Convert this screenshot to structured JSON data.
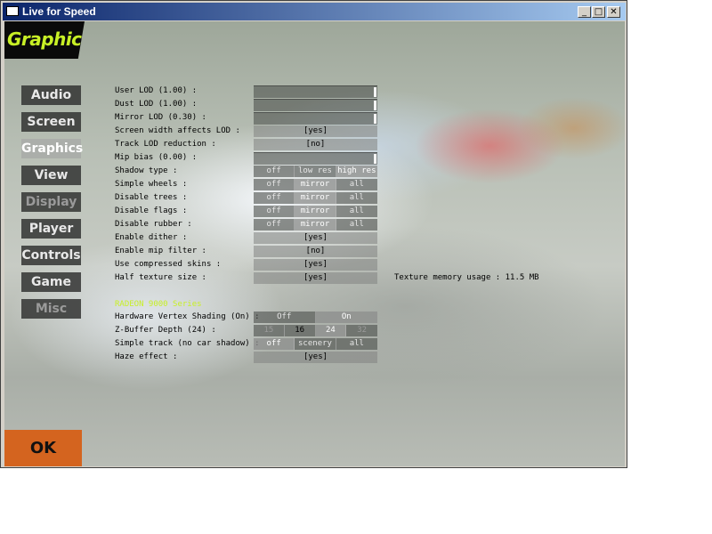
{
  "window": {
    "title": "Live for Speed",
    "minimize": "_",
    "maximize": "□",
    "close": "✕"
  },
  "logo": "Graphics",
  "nav": [
    {
      "label": "Audio",
      "state": "normal"
    },
    {
      "label": "Screen",
      "state": "normal"
    },
    {
      "label": "Graphics",
      "state": "active"
    },
    {
      "label": "View",
      "state": "normal"
    },
    {
      "label": "Display",
      "state": "dim"
    },
    {
      "label": "Player",
      "state": "normal"
    },
    {
      "label": "Controls",
      "state": "normal"
    },
    {
      "label": "Game",
      "state": "normal"
    },
    {
      "label": "Misc",
      "state": "dim"
    }
  ],
  "ok_label": "OK",
  "settings": [
    {
      "label": "User LOD (1.00) :",
      "type": "slider",
      "value": 1.0
    },
    {
      "label": "Dust LOD (1.00) :",
      "type": "slider",
      "value": 1.0
    },
    {
      "label": "Mirror LOD (0.30) :",
      "type": "slider",
      "value": 0.3
    },
    {
      "label": "Screen width affects LOD :",
      "type": "yesno",
      "value": "[yes]"
    },
    {
      "label": "Track LOD reduction :",
      "type": "yesno",
      "value": "[no]"
    },
    {
      "label": "Mip bias (0.00) :",
      "type": "slider",
      "value": 0.0
    },
    {
      "label": "Shadow type :",
      "type": "seg",
      "options": [
        "off",
        "low res",
        "high res"
      ],
      "selected": 2
    },
    {
      "label": "Simple wheels :",
      "type": "seg",
      "options": [
        "off",
        "mirror",
        "all"
      ],
      "selected": 1
    },
    {
      "label": "Disable trees :",
      "type": "seg",
      "options": [
        "off",
        "mirror",
        "all"
      ],
      "selected": 1
    },
    {
      "label": "Disable flags :",
      "type": "seg",
      "options": [
        "off",
        "mirror",
        "all"
      ],
      "selected": 1
    },
    {
      "label": "Disable rubber :",
      "type": "seg",
      "options": [
        "off",
        "mirror",
        "all"
      ],
      "selected": 1
    },
    {
      "label": "Enable dither :",
      "type": "yesno",
      "value": "[yes]"
    },
    {
      "label": "Enable mip filter :",
      "type": "yesno",
      "value": "[no]"
    },
    {
      "label": "Use compressed skins :",
      "type": "yesno",
      "value": "[yes]"
    },
    {
      "label": "Half texture size :",
      "type": "yesno",
      "value": "[yes]"
    }
  ],
  "texture_memory": "Texture memory usage : 11.5 MB",
  "hardware_section": "RADEON 9000 Series",
  "hardware_settings": [
    {
      "label": "Hardware Vertex Shading (On) :",
      "type": "seg",
      "options": [
        "Off",
        "On"
      ],
      "selected": 1
    },
    {
      "label": "Z-Buffer Depth (24) :",
      "type": "seg",
      "options": [
        "15",
        "16",
        "24",
        "32"
      ],
      "selected": 2,
      "disabled": [
        0,
        3
      ]
    },
    {
      "label": "Simple track (no car shadow) :",
      "type": "seg",
      "options": [
        "off",
        "scenery",
        "all"
      ],
      "selected": 0
    },
    {
      "label": "Haze effect :",
      "type": "yesno",
      "value": "[yes]"
    }
  ]
}
